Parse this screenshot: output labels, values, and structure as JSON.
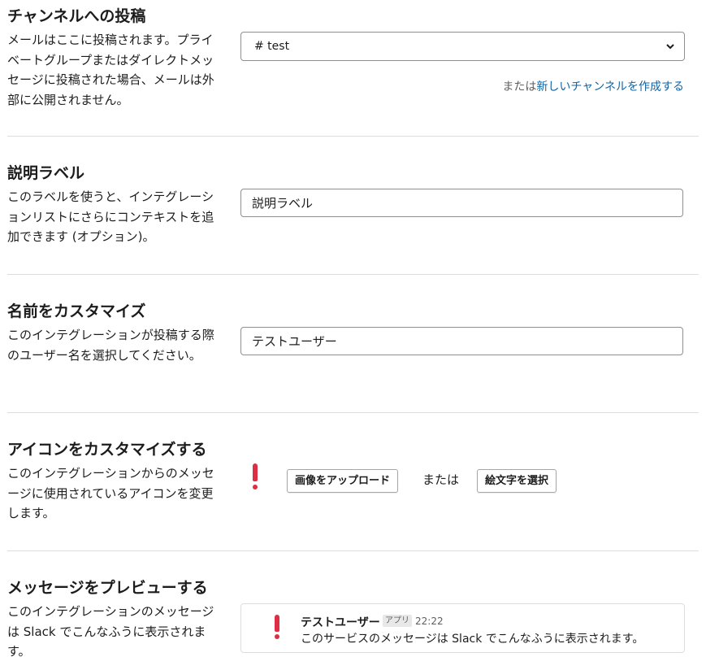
{
  "channel": {
    "title": "チャンネルへの投稿",
    "description": "メールはここに投稿されます。プライベートグループまたはダイレクトメッセージに投稿された場合、メールは外部に公開されません。",
    "select_value": "# test",
    "chevron": "chevron-down-icon",
    "or_text": "または",
    "create_link": "新しいチャンネルを作成する"
  },
  "label": {
    "title": "説明ラベル",
    "description": "このラベルを使うと、インテグレーションリストにさらにコンテキストを追加できます (オプション)。",
    "value": "説明ラベル"
  },
  "name": {
    "title": "名前をカスタマイズ",
    "description": "このインテグレーションが投稿する際のユーザー名を選択してください。",
    "value": "テストユーザー"
  },
  "icon": {
    "title": "アイコンをカスタマイズする",
    "description": "このインテグレーションからのメッセージに使用されているアイコンを変更します。",
    "current_icon": "exclamation-icon",
    "upload_label": "画像をアップロード",
    "or_text": "または",
    "emoji_label": "絵文字を選択"
  },
  "preview": {
    "title": "メッセージをプレビューする",
    "description": "このインテグレーションのメッセージは Slack でこんなふうに表示されます。",
    "user": "テストユーザー",
    "badge": "アプリ",
    "time": "22:22",
    "message": "このサービスのメッセージは Slack でこんなふうに表示されます。"
  },
  "colors": {
    "link": "#1264a3",
    "accent_red": "#dd2e44",
    "border": "#dddddd"
  }
}
